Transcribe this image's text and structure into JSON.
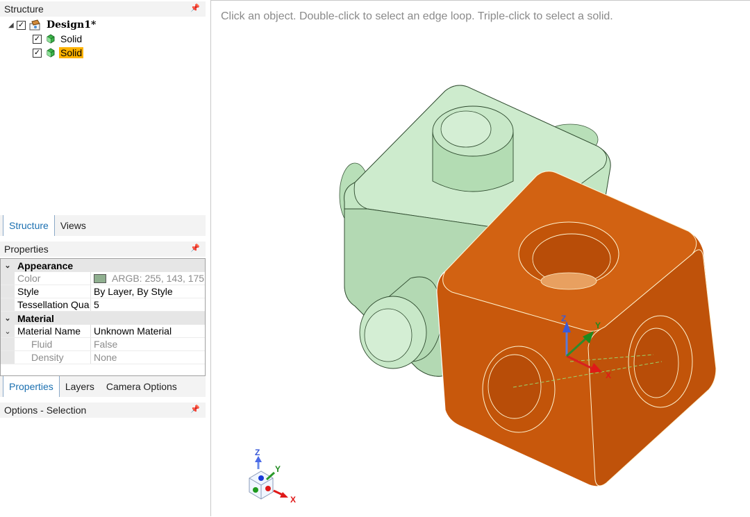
{
  "structure_panel": {
    "title": "Structure",
    "tree": [
      {
        "label": "Design1*",
        "checked": true,
        "icon": "design-icon"
      },
      {
        "label": "Solid",
        "checked": true,
        "icon": "solid-cube-icon"
      },
      {
        "label": "Solid",
        "checked": true,
        "icon": "solid-cube-icon",
        "selected": true
      }
    ],
    "tabs": [
      "Structure",
      "Views"
    ]
  },
  "properties_panel": {
    "title": "Properties",
    "appearance": {
      "category": "Appearance",
      "color_label": "Color",
      "color_value": "ARGB: 255, 143, 175",
      "style_label": "Style",
      "style_value": "By Layer, By Style",
      "tess_label": "Tessellation Qua",
      "tess_value": "5"
    },
    "material": {
      "category": "Material",
      "name_label": "Material Name",
      "name_value": "Unknown Material",
      "fluid_label": "Fluid",
      "fluid_value": "False",
      "density_label": "Density",
      "density_value": "None"
    },
    "tabs": [
      "Properties",
      "Layers",
      "Camera Options"
    ]
  },
  "options_panel": {
    "title": "Options - Selection"
  },
  "viewport": {
    "hint": "Click an object. Double-click to select an edge loop. Triple-click to select a solid.",
    "axis_labels": {
      "x": "X",
      "y": "Y",
      "z": "Z"
    }
  },
  "colors": {
    "selected_highlight": "#ffb300",
    "green_solid": "#c3e6c3",
    "orange_solid": "#c8580c",
    "swatch": "#8faf8f",
    "active_tab_text": "#1a6fb0"
  }
}
